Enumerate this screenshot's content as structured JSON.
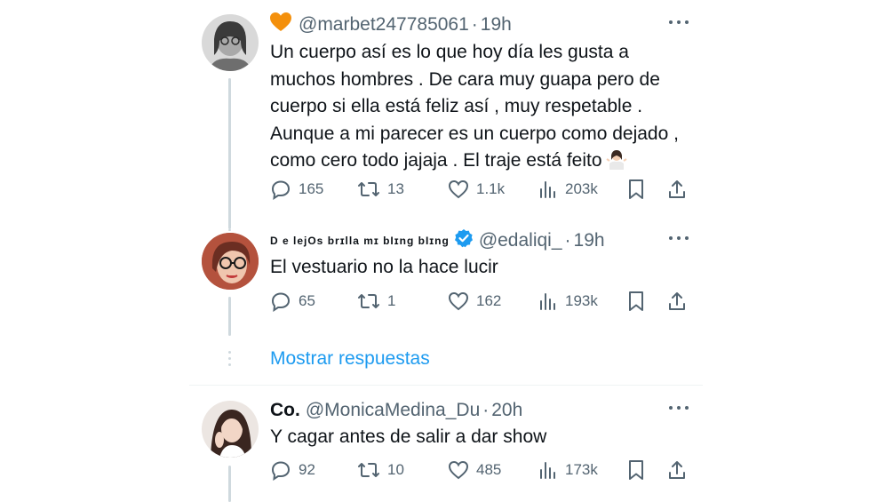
{
  "tweets": [
    {
      "display_name": "",
      "badge_icon": "orange-heart-icon",
      "handle": "@marbet247785061",
      "time": "19h",
      "text": "Un cuerpo así es lo que hoy día les gusta a muchos hombres . De cara muy guapa pero de cuerpo si ella está feliz así , muy respetable . Aunque a mi parecer es un cuerpo como dejado , como cero todo jajaja . El traje está feito",
      "emoji_icon": "woman-shrugging-emoji-icon",
      "replies": "165",
      "retweets": "13",
      "likes": "1.1k",
      "views": "203k"
    },
    {
      "display_name": "D e lejOs brɪlla mɪ bIɪng bIɪng",
      "verified": true,
      "handle": "@edaliqi_",
      "time": "19h",
      "text": "El vestuario no la hace lucir",
      "replies": "65",
      "retweets": "1",
      "likes": "162",
      "views": "193k"
    },
    {
      "display_name": "Co.",
      "handle": "@MonicaMedina_Du",
      "time": "20h",
      "text": "Y cagar antes de salir a dar show",
      "replies": "92",
      "retweets": "10",
      "likes": "485",
      "views": "173k"
    }
  ],
  "show_replies_label": "Mostrar respuestas",
  "separator": "·",
  "colors": {
    "text": "#0f1419",
    "secondary": "#536471",
    "link": "#1d9bf0",
    "verified": "#1d9bf0",
    "heart": "#f4900c"
  }
}
